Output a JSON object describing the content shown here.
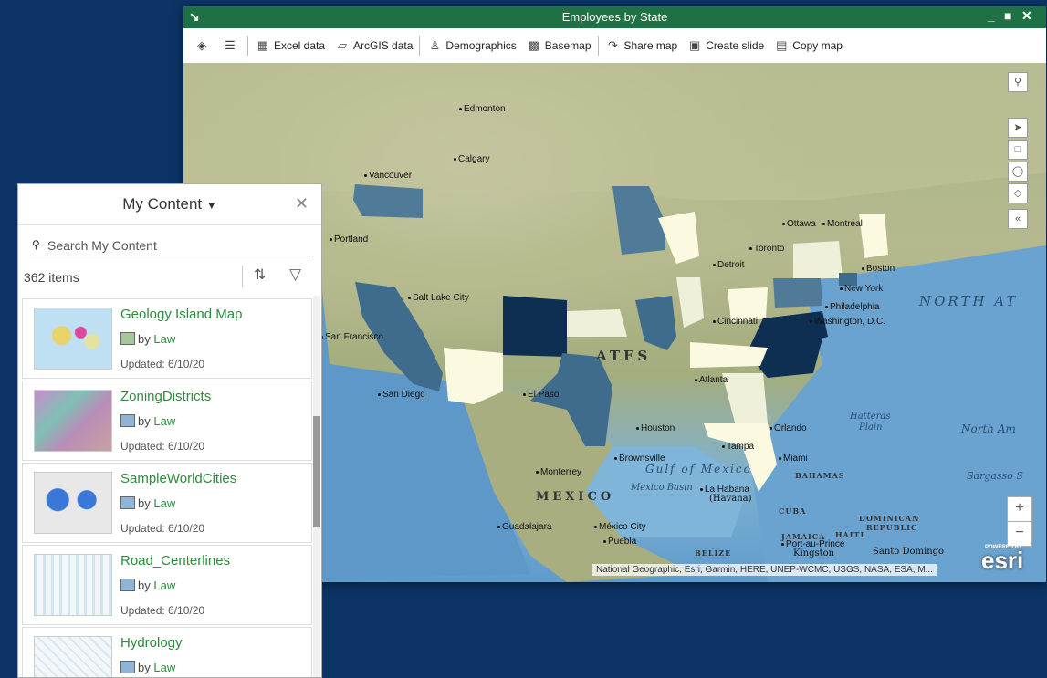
{
  "map_window": {
    "title": "Employees by State",
    "toolbar": {
      "excel_data": "Excel data",
      "arcgis_data": "ArcGIS data",
      "demographics": "Demographics",
      "basemap": "Basemap",
      "share_map": "Share map",
      "create_slide": "Create slide",
      "copy_map": "Copy map"
    },
    "cities": {
      "edmonton": "Edmonton",
      "calgary": "Calgary",
      "vancouver": "Vancouver",
      "portland": "Portland",
      "salt_lake": "Salt Lake City",
      "san_francisco": "San Francisco",
      "san_diego": "San Diego",
      "el_paso": "El Paso",
      "houston": "Houston",
      "brownsville": "Brownsville",
      "monterrey": "Monterrey",
      "guadalajara": "Guadalajara",
      "mexico_city": "México City",
      "puebla": "Puebla",
      "ottawa": "Ottawa",
      "montreal": "Montréal",
      "toronto": "Toronto",
      "detroit": "Detroit",
      "boston": "Boston",
      "new_york": "New York",
      "philadelphia": "Philadelphia",
      "washington": "Washington, D.C.",
      "cincinnati": "Cincinnati",
      "atlanta": "Atlanta",
      "tampa": "Tampa",
      "orlando": "Orlando",
      "miami": "Miami",
      "la_habana": "La Habana",
      "havana": "(Havana)",
      "port_au_prince": "Port-au-Prince",
      "kingston": "Kingston",
      "santo_domingo": "Santo Domingo"
    },
    "labels": {
      "north_atlantic": "NORTH AT",
      "mexico_country": "MEXICO",
      "united_states": "ATES",
      "gulf_of_mexico": "Gulf of Mexico",
      "mexico_basin": "Mexico Basin",
      "hatteras": "Hatteras",
      "hatteras_plain": "Plain",
      "north_american": "North Am",
      "sargasso": "Sargasso S",
      "bahamas": "BAHAMAS",
      "cuba": "CUBA",
      "jamaica": "JAMAICA",
      "haiti": "HAITI",
      "dominican": "DOMINICAN",
      "republic": "REPUBLIC",
      "belize": "BELIZE"
    },
    "attribution": "National Geographic, Esri, Garmin, HERE, UNEP-WCMC, USGS, NASA, ESA, M...",
    "esri_logo": "esri",
    "powered_by": "POWERED BY"
  },
  "content_pane": {
    "title": "My Content",
    "search_placeholder": "Search My Content",
    "items_count": "362 items",
    "items": [
      {
        "title": "Geology Island Map",
        "by": "by",
        "owner": "Law",
        "updated": "Updated: 6/10/20"
      },
      {
        "title": "ZoningDistricts",
        "by": "by",
        "owner": "Law",
        "updated": "Updated: 6/10/20"
      },
      {
        "title": "SampleWorldCities",
        "by": "by",
        "owner": "Law",
        "updated": "Updated: 6/10/20"
      },
      {
        "title": "Road_Centerlines",
        "by": "by",
        "owner": "Law",
        "updated": "Updated: 6/10/20"
      },
      {
        "title": "Hydrology",
        "by": "by",
        "owner": "Law",
        "updated": ""
      }
    ]
  },
  "colors": {
    "title_bar": "#1e7145",
    "accent_text": "#2e8b3d",
    "background": "#0c3465",
    "state_darkest": "#0e2e52",
    "state_dark": "#3f6c8c",
    "state_light": "#eef0d9",
    "state_lightest": "#fbf9e0"
  }
}
